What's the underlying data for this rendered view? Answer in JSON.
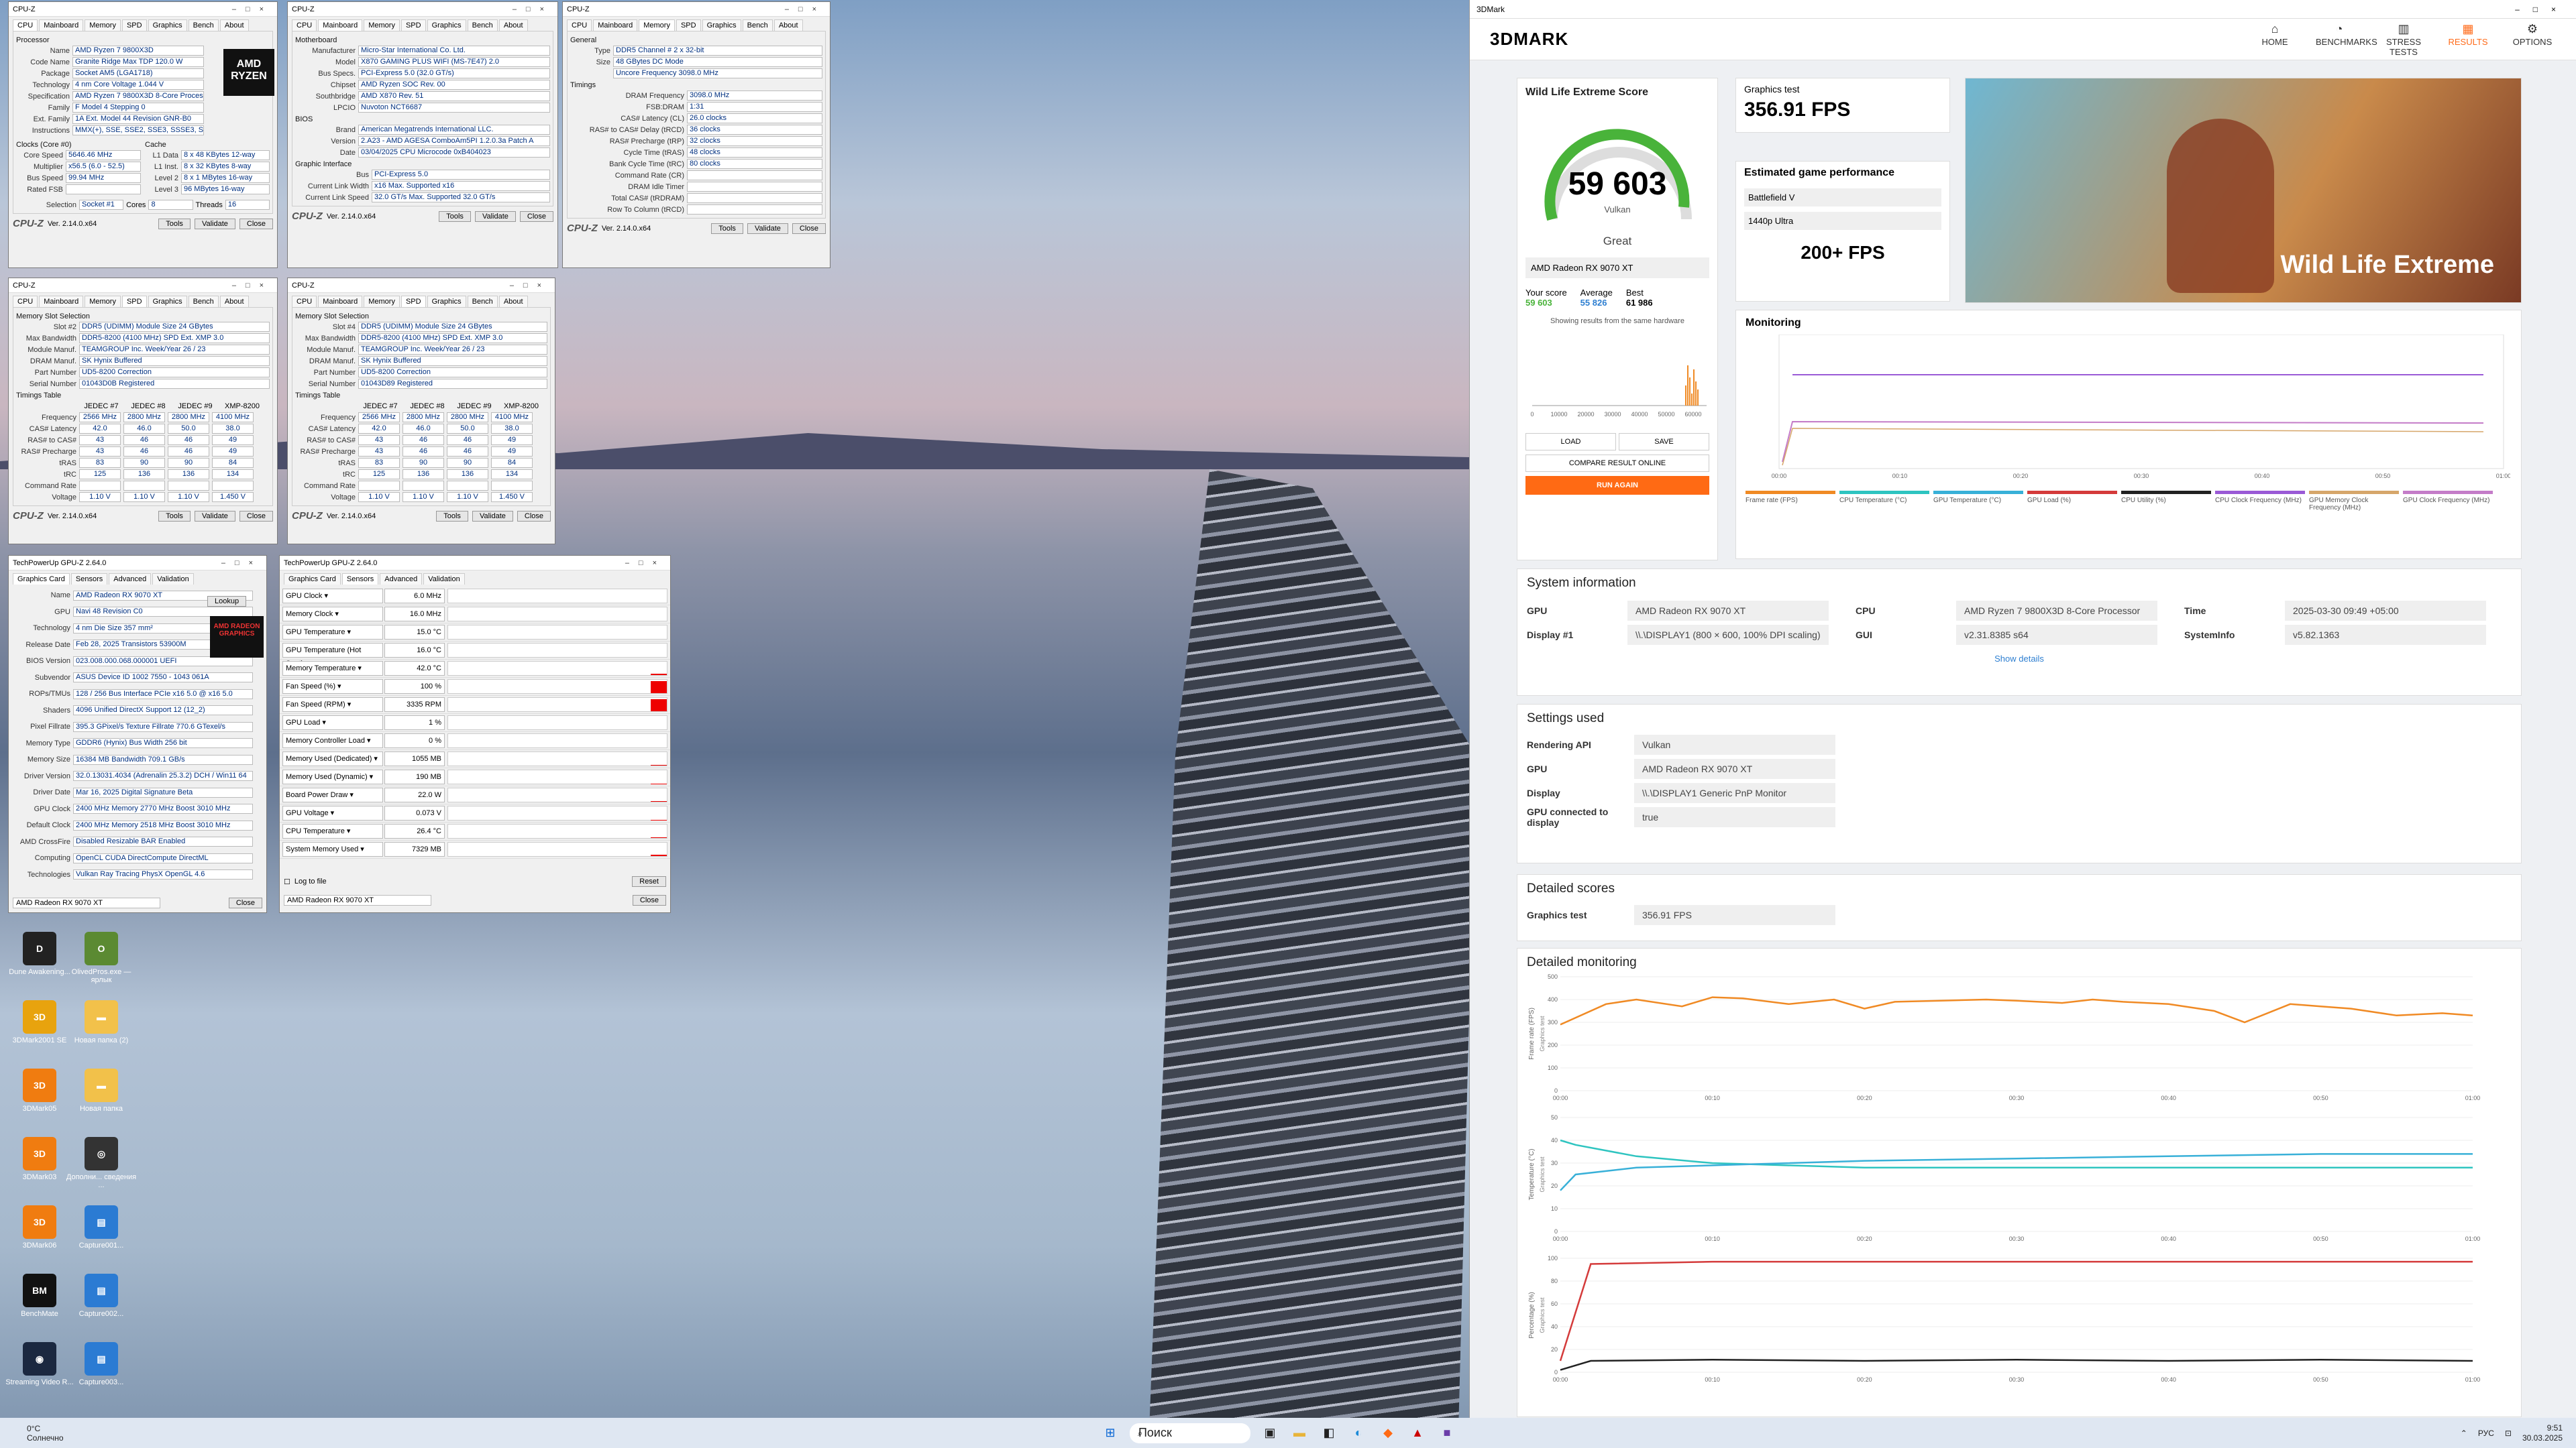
{
  "desktop": {
    "icons": [
      {
        "label": "Dune Awakening...",
        "color": "#222",
        "glyph": "D"
      },
      {
        "label": "OlivedPros.exe — ярлык",
        "color": "#5b8a32",
        "glyph": "O"
      },
      {
        "label": "3DMark2001 SE",
        "color": "#e8a30e",
        "glyph": "3D"
      },
      {
        "label": "Новая папка (2)",
        "color": "#f2c14a",
        "glyph": "▬"
      },
      {
        "label": "3DMark05",
        "color": "#f07c10",
        "glyph": "3D"
      },
      {
        "label": "Новая папка",
        "color": "#f2c14a",
        "glyph": "▬"
      },
      {
        "label": "3DMark03",
        "color": "#f07c10",
        "glyph": "3D"
      },
      {
        "label": "Дополни... сведения ...",
        "color": "#333",
        "glyph": "◎"
      },
      {
        "label": "3DMark06",
        "color": "#f07c10",
        "glyph": "3D"
      },
      {
        "label": "Capture001...",
        "color": "#2b7bd3",
        "glyph": "▤"
      },
      {
        "label": "BenchMate",
        "color": "#111",
        "glyph": "BM"
      },
      {
        "label": "Capture002...",
        "color": "#2b7bd3",
        "glyph": "▤"
      },
      {
        "label": "Streaming Video R...",
        "color": "#1b2840",
        "glyph": "◉"
      },
      {
        "label": "Capture003...",
        "color": "#2b7bd3",
        "glyph": "▤"
      }
    ]
  },
  "cpuz_cpu": {
    "title": "CPU-Z",
    "tabs": [
      "CPU",
      "Mainboard",
      "Memory",
      "SPD",
      "Graphics",
      "Bench",
      "About"
    ],
    "processor": "Processor",
    "rows": [
      [
        "Name",
        "AMD Ryzen 7 9800X3D"
      ],
      [
        "Code Name",
        "Granite Ridge     Max TDP 120.0 W"
      ],
      [
        "Package",
        "Socket AM5 (LGA1718)"
      ],
      [
        "Technology",
        "4 nm     Core Voltage 1.044 V"
      ],
      [
        "Specification",
        "AMD Ryzen 7 9800X3D 8-Core Processor"
      ],
      [
        "Family",
        "F   Model 4   Stepping 0"
      ],
      [
        "Ext. Family",
        "1A  Ext. Model 44  Revision GNR-B0"
      ],
      [
        "Instructions",
        "MMX(+), SSE, SSE2, SSE3, SSSE3, SSE4.1, SSE4.2, SSE4A, x86-64, AMD-V, AES, AVX, AVX2, AVX-VNNI, AVX512, FMA3,"
      ]
    ],
    "clocks": "Clocks (Core #0)",
    "cache": "Cache",
    "clock_rows": [
      [
        "Core Speed",
        "5646.46 MHz"
      ],
      [
        "Multiplier",
        "x56.5 (6.0 - 52.5)"
      ],
      [
        "Bus Speed",
        "99.94 MHz"
      ],
      [
        "Rated FSB",
        ""
      ]
    ],
    "cache_rows": [
      [
        "L1 Data",
        "8 x 48 KBytes  12-way"
      ],
      [
        "L1 Inst.",
        "8 x 32 KBytes  8-way"
      ],
      [
        "Level 2",
        "8 x 1 MBytes  16-way"
      ],
      [
        "Level 3",
        "96 MBytes  16-way"
      ]
    ],
    "selection": "Socket #1",
    "cores": "8",
    "threads": "16",
    "version": "Ver. 2.14.0.x64",
    "tools": "Tools",
    "validate": "Validate",
    "close": "Close",
    "logo": "CPU-Z",
    "cores_label": "Cores",
    "threads_label": "Threads",
    "selection_label": "Selection"
  },
  "cpuz_mb": {
    "title": "CPU-Z",
    "tabs": [
      "CPU",
      "Mainboard",
      "Memory",
      "SPD",
      "Graphics",
      "Bench",
      "About"
    ],
    "grp1": "Motherboard",
    "rows": [
      [
        "Manufacturer",
        "Micro-Star International Co. Ltd."
      ],
      [
        "Model",
        "X870 GAMING PLUS WIFI (MS-7E47)   2.0"
      ],
      [
        "Bus Specs.",
        "PCI-Express 5.0 (32.0 GT/s)"
      ],
      [
        "Chipset",
        "AMD    Ryzen SOC   Rev. 00"
      ],
      [
        "Southbridge",
        "AMD    X870        Rev. 51"
      ],
      [
        "LPCIO",
        "Nuvoton   NCT6687"
      ]
    ],
    "grp2": "BIOS",
    "bios": [
      [
        "Brand",
        "American Megatrends International LLC."
      ],
      [
        "Version",
        "2.A23 - AMD AGESA ComboAm5PI 1.2.0.3a Patch A"
      ],
      [
        "Date",
        "03/04/2025   CPU Microcode 0xB404023"
      ]
    ],
    "grp3": "Graphic Interface",
    "gi": [
      [
        "Bus",
        "PCI-Express 5.0"
      ],
      [
        "Current Link Width",
        "x16   Max. Supported x16"
      ],
      [
        "Current Link Speed",
        "32.0 GT/s   Max. Supported 32.0 GT/s"
      ]
    ],
    "version": "Ver. 2.14.0.x64",
    "tools": "Tools",
    "validate": "Validate",
    "close": "Close",
    "logo": "CPU-Z"
  },
  "cpuz_mem": {
    "title": "CPU-Z",
    "tabs": [
      "CPU",
      "Mainboard",
      "Memory",
      "SPD",
      "Graphics",
      "Bench",
      "About"
    ],
    "grp1": "General",
    "rows": [
      [
        "Type",
        "DDR5     Channel # 2 x 32-bit"
      ],
      [
        "Size",
        "48 GBytes   DC Mode"
      ],
      [
        "",
        "Uncore Frequency 3098.0 MHz"
      ]
    ],
    "grp2": "Timings",
    "timings": [
      [
        "DRAM Frequency",
        "3098.0 MHz"
      ],
      [
        "FSB:DRAM",
        "1:31"
      ],
      [
        "CAS# Latency (CL)",
        "26.0 clocks"
      ],
      [
        "RAS# to CAS# Delay (tRCD)",
        "36 clocks"
      ],
      [
        "RAS# Precharge (tRP)",
        "32 clocks"
      ],
      [
        "Cycle Time (tRAS)",
        "48 clocks"
      ],
      [
        "Bank Cycle Time (tRC)",
        "80 clocks"
      ],
      [
        "Command Rate (CR)",
        ""
      ],
      [
        "DRAM Idle Timer",
        ""
      ],
      [
        "Total CAS# (tRDRAM)",
        ""
      ],
      [
        "Row To Column (tRCD)",
        ""
      ]
    ],
    "version": "Ver. 2.14.0.x64",
    "tools": "Tools",
    "validate": "Validate",
    "close": "Close",
    "logo": "CPU-Z"
  },
  "cpuz_spd1": {
    "title": "CPU-Z",
    "tabs": [
      "CPU",
      "Mainboard",
      "Memory",
      "SPD",
      "Graphics",
      "Bench",
      "About"
    ],
    "grp1": "Memory Slot Selection",
    "rows": [
      [
        "Slot #2",
        "DDR5 (UDIMM)   Module Size 24 GBytes"
      ],
      [
        "Max Bandwidth",
        "DDR5-8200 (4100 MHz)  SPD Ext. XMP 3.0"
      ],
      [
        "Module Manuf.",
        "TEAMGROUP Inc.   Week/Year 26 / 23"
      ],
      [
        "DRAM Manuf.",
        "SK Hynix   Buffered"
      ],
      [
        "Part Number",
        "UD5-8200   Correction"
      ],
      [
        "Serial Number",
        "01043D0B   Registered"
      ]
    ],
    "grp2": "Timings Table",
    "cols": [
      "",
      "JEDEC #7",
      "JEDEC #8",
      "JEDEC #9",
      "XMP-8200"
    ],
    "trows": [
      [
        "Frequency",
        "2566 MHz",
        "2800 MHz",
        "2800 MHz",
        "4100 MHz"
      ],
      [
        "CAS# Latency",
        "42.0",
        "46.0",
        "50.0",
        "38.0"
      ],
      [
        "RAS# to CAS#",
        "43",
        "46",
        "46",
        "49"
      ],
      [
        "RAS# Precharge",
        "43",
        "46",
        "46",
        "49"
      ],
      [
        "tRAS",
        "83",
        "90",
        "90",
        "84"
      ],
      [
        "tRC",
        "125",
        "136",
        "136",
        "134"
      ],
      [
        "Command Rate",
        "",
        "",
        "",
        ""
      ],
      [
        "Voltage",
        "1.10 V",
        "1.10 V",
        "1.10 V",
        "1.450 V"
      ]
    ],
    "version": "Ver. 2.14.0.x64",
    "tools": "Tools",
    "validate": "Validate",
    "close": "Close",
    "logo": "CPU-Z"
  },
  "cpuz_spd2": {
    "title": "CPU-Z",
    "tabs": [
      "CPU",
      "Mainboard",
      "Memory",
      "SPD",
      "Graphics",
      "Bench",
      "About"
    ],
    "grp1": "Memory Slot Selection",
    "rows": [
      [
        "Slot #4",
        "DDR5 (UDIMM)   Module Size 24 GBytes"
      ],
      [
        "Max Bandwidth",
        "DDR5-8200 (4100 MHz)  SPD Ext. XMP 3.0"
      ],
      [
        "Module Manuf.",
        "TEAMGROUP Inc.   Week/Year 26 / 23"
      ],
      [
        "DRAM Manuf.",
        "SK Hynix   Buffered"
      ],
      [
        "Part Number",
        "UD5-8200   Correction"
      ],
      [
        "Serial Number",
        "01043D89   Registered"
      ]
    ],
    "grp2": "Timings Table",
    "cols": [
      "",
      "JEDEC #7",
      "JEDEC #8",
      "JEDEC #9",
      "XMP-8200"
    ],
    "trows": [
      [
        "Frequency",
        "2566 MHz",
        "2800 MHz",
        "2800 MHz",
        "4100 MHz"
      ],
      [
        "CAS# Latency",
        "42.0",
        "46.0",
        "50.0",
        "38.0"
      ],
      [
        "RAS# to CAS#",
        "43",
        "46",
        "46",
        "49"
      ],
      [
        "RAS# Precharge",
        "43",
        "46",
        "46",
        "49"
      ],
      [
        "tRAS",
        "83",
        "90",
        "90",
        "84"
      ],
      [
        "tRC",
        "125",
        "136",
        "136",
        "134"
      ],
      [
        "Command Rate",
        "",
        "",
        "",
        ""
      ],
      [
        "Voltage",
        "1.10 V",
        "1.10 V",
        "1.10 V",
        "1.450 V"
      ]
    ],
    "version": "Ver. 2.14.0.x64",
    "tools": "Tools",
    "validate": "Validate",
    "close": "Close",
    "logo": "CPU-Z"
  },
  "gpuz1": {
    "title": "TechPowerUp GPU-Z 2.64.0",
    "tabs": [
      "Graphics Card",
      "Sensors",
      "Advanced",
      "Validation"
    ],
    "rows": [
      [
        "Name",
        "AMD Radeon RX 9070 XT"
      ],
      [
        "GPU",
        "Navi 48   Revision C0"
      ],
      [
        "Technology",
        "4 nm   Die Size 357 mm²"
      ],
      [
        "Release Date",
        "Feb 28, 2025   Transistors 53900M"
      ],
      [
        "BIOS Version",
        "023.008.000.068.000001   UEFI"
      ],
      [
        "Subvendor",
        "ASUS   Device ID 1002 7550 - 1043 061A"
      ],
      [
        "ROPs/TMUs",
        "128 / 256   Bus Interface PCIe x16 5.0 @ x16 5.0"
      ],
      [
        "Shaders",
        "4096 Unified   DirectX Support 12 (12_2)"
      ],
      [
        "Pixel Fillrate",
        "395.3 GPixel/s   Texture Fillrate 770.6 GTexel/s"
      ],
      [
        "Memory Type",
        "GDDR6 (Hynix)   Bus Width 256 bit"
      ],
      [
        "Memory Size",
        "16384 MB   Bandwidth 709.1 GB/s"
      ],
      [
        "Driver Version",
        "32.0.13031.4034 (Adrenalin 25.3.2) DCH / Win11 64"
      ],
      [
        "Driver Date",
        "Mar 16, 2025   Digital Signature Beta"
      ],
      [
        "GPU Clock",
        "2400 MHz  Memory 2770 MHz  Boost 3010 MHz"
      ],
      [
        "Default Clock",
        "2400 MHz  Memory 2518 MHz  Boost 3010 MHz"
      ],
      [
        "AMD CrossFire",
        "Disabled   Resizable BAR Enabled"
      ],
      [
        "Computing",
        "OpenCL  CUDA  DirectCompute  DirectML"
      ],
      [
        "Technologies",
        "Vulkan  Ray Tracing  PhysX  OpenGL 4.6"
      ]
    ],
    "lookup": "Lookup",
    "select": "AMD Radeon RX 9070 XT",
    "close": "Close",
    "brand": "AMD RADEON GRAPHICS"
  },
  "gpuz2": {
    "title": "TechPowerUp GPU-Z 2.64.0",
    "tabs": [
      "Graphics Card",
      "Sensors",
      "Advanced",
      "Validation"
    ],
    "sensors": [
      [
        "GPU Clock",
        "6.0 MHz",
        0
      ],
      [
        "Memory Clock",
        "16.0 MHz",
        0
      ],
      [
        "GPU Temperature",
        "15.0 °C",
        0
      ],
      [
        "GPU Temperature (Hot Spot)",
        "16.0 °C",
        0
      ],
      [
        "Memory Temperature",
        "42.0 °C",
        0.1
      ],
      [
        "Fan Speed (%)",
        "100 %",
        0.9
      ],
      [
        "Fan Speed (RPM)",
        "3335 RPM",
        0.9
      ],
      [
        "GPU Load",
        "1 %",
        0
      ],
      [
        "Memory Controller Load",
        "0 %",
        0
      ],
      [
        "Memory Used (Dedicated)",
        "1055 MB",
        0.05
      ],
      [
        "Memory Used (Dynamic)",
        "190 MB",
        0.02
      ],
      [
        "Board Power Draw",
        "22.0 W",
        0.05
      ],
      [
        "GPU Voltage",
        "0.073 V",
        0.02
      ],
      [
        "CPU Temperature",
        "26.4 °C",
        0.05
      ],
      [
        "System Memory Used",
        "7329 MB",
        0.1
      ]
    ],
    "log": "Log to file",
    "reset": "Reset",
    "select": "AMD Radeon RX 9070 XT",
    "close": "Close"
  },
  "dmark": {
    "window_title": "3DMark",
    "brand": "3DMARK",
    "nav": [
      {
        "icon": "⌂",
        "label": "HOME"
      },
      {
        "icon": "◔",
        "label": "BENCHMARKS"
      },
      {
        "icon": "▥",
        "label": "STRESS TESTS"
      },
      {
        "icon": "▦",
        "label": "RESULTS"
      },
      {
        "icon": "⚙",
        "label": "OPTIONS"
      }
    ],
    "score_title": "Wild Life Extreme Score",
    "score": "59 603",
    "api": "Vulkan",
    "rating": "Great",
    "gpu_name": "AMD Radeon RX 9070 XT",
    "your_label": "Your score",
    "your": "59 603",
    "avg_label": "Average",
    "avg": "55 826",
    "best_label": "Best",
    "best": "61 986",
    "hist_note": "Showing results from the same hardware",
    "hist_ticks": [
      "0",
      "10000",
      "20000",
      "30000",
      "40000",
      "50000",
      "60000"
    ],
    "load": "LOAD",
    "save": "SAVE",
    "compare": "COMPARE RESULT ONLINE",
    "run": "RUN AGAIN",
    "gt_label": "Graphics test",
    "gt_value": "356.91 FPS",
    "egp_label": "Estimated game performance",
    "game": "Battlefield V",
    "res": "1440p Ultra",
    "egp_value": "200+ FPS",
    "banner": "Wild Life Extreme",
    "monitoring": "Monitoring",
    "legend": [
      {
        "label": "Frame rate (FPS)",
        "color": "#f08a24"
      },
      {
        "label": "CPU Temperature (°C)",
        "color": "#2ec4c0"
      },
      {
        "label": "GPU Temperature (°C)",
        "color": "#38b0d8"
      },
      {
        "label": "GPU Load (%)",
        "color": "#d43b3b"
      },
      {
        "label": "CPU Utility (%)",
        "color": "#222222"
      },
      {
        "label": "CPU Clock Frequency (MHz)",
        "color": "#9a5ad6"
      },
      {
        "label": "GPU Memory Clock Frequency (MHz)",
        "color": "#d6a66a"
      },
      {
        "label": "GPU Clock Frequency (MHz)",
        "color": "#c47cc8"
      }
    ],
    "time_ticks": [
      "00:00",
      "00:10",
      "00:20",
      "00:30",
      "00:40",
      "00:50",
      "01:00"
    ],
    "sysinfo": "System information",
    "si": [
      [
        "GPU",
        "AMD Radeon RX 9070 XT"
      ],
      [
        "Display #1",
        "\\\\.\\DISPLAY1 (800 × 600, 100% DPI scaling)"
      ],
      [
        "CPU",
        "AMD Ryzen 7 9800X3D 8-Core Processor"
      ],
      [
        "GUI",
        "v2.31.8385 s64"
      ],
      [
        "Time",
        "2025-03-30 09:49 +05:00"
      ],
      [
        "SystemInfo",
        "v5.82.1363"
      ]
    ],
    "show_details": "Show details",
    "settings": "Settings used",
    "set": [
      [
        "Rendering API",
        "Vulkan"
      ],
      [
        "GPU",
        "AMD Radeon RX 9070 XT"
      ],
      [
        "Display",
        "\\\\.\\DISPLAY1 Generic PnP Monitor"
      ],
      [
        "GPU connected to display",
        "true"
      ]
    ],
    "detailed": "Detailed scores",
    "ds": [
      [
        "Graphics test",
        "356.91 FPS"
      ]
    ],
    "dmon": "Detailed monitoring",
    "fps_axis": "Frame rate (FPS)",
    "temp_axis": "Temperature (°C)",
    "pct_axis": "Percentage (%)",
    "gt_tag": "Graphics test"
  },
  "taskbar": {
    "weather": "0°C",
    "weather_sub": "Солнечно",
    "search": "Поиск",
    "lang": "РУС",
    "time": "9:51",
    "date": "30.03.2025"
  },
  "chart_data": [
    {
      "type": "line",
      "title": "Frame rate (FPS)",
      "x": [
        0,
        3,
        5,
        8,
        10,
        12,
        15,
        18,
        20,
        22,
        25,
        28,
        30,
        33,
        35,
        37,
        40,
        43,
        45,
        48,
        50,
        52,
        55,
        58,
        60
      ],
      "series": [
        {
          "name": "Frame rate (FPS)",
          "values": [
            290,
            380,
            400,
            370,
            410,
            405,
            380,
            400,
            360,
            390,
            395,
            400,
            395,
            385,
            400,
            390,
            380,
            350,
            300,
            380,
            370,
            360,
            330,
            340,
            330
          ]
        }
      ],
      "ylim": [
        0,
        500
      ]
    },
    {
      "type": "line",
      "title": "Temperature (°C)",
      "x": [
        0,
        1,
        5,
        10,
        20,
        30,
        40,
        50,
        60
      ],
      "series": [
        {
          "name": "CPU Temperature (°C)",
          "values": [
            40,
            38,
            33,
            30,
            28,
            28,
            28,
            28,
            28
          ]
        },
        {
          "name": "GPU Temperature (°C)",
          "values": [
            18,
            25,
            28,
            29,
            31,
            32,
            33,
            34,
            34
          ]
        }
      ],
      "ylim": [
        0,
        50
      ]
    },
    {
      "type": "line",
      "title": "Percentage (%)",
      "x": [
        0,
        2,
        10,
        20,
        30,
        40,
        50,
        60
      ],
      "series": [
        {
          "name": "GPU Load (%)",
          "values": [
            10,
            95,
            97,
            97,
            97,
            97,
            97,
            97
          ]
        },
        {
          "name": "CPU Utility (%)",
          "values": [
            2,
            10,
            11,
            10,
            11,
            10,
            11,
            10
          ]
        }
      ],
      "ylim": [
        0,
        100
      ]
    }
  ]
}
